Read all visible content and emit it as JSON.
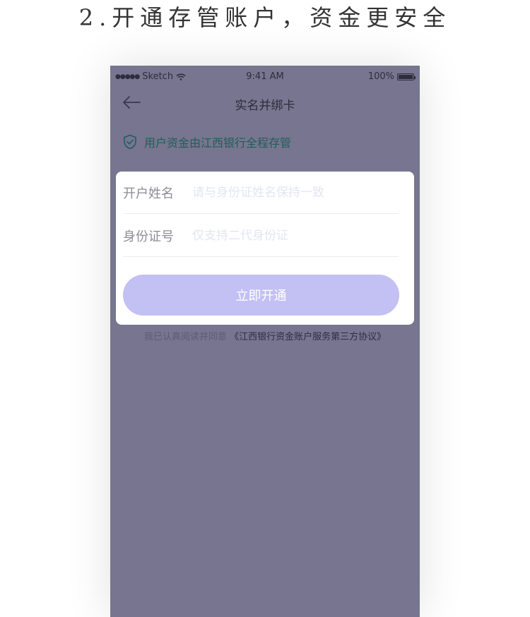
{
  "headline": "2.开通存管账户，资金更安全",
  "statusbar": {
    "carrier": "Sketch",
    "time": "9:41 AM",
    "battery": "100%"
  },
  "nav": {
    "title": "实名并绑卡"
  },
  "notice": {
    "text": "用户资金由江西银行全程存管"
  },
  "form": {
    "name_label": "开户姓名",
    "name_placeholder": "请与身份证姓名保持一致",
    "id_label": "身份证号",
    "id_placeholder": "仅支持二代身份证",
    "submit_label": "立即开通"
  },
  "agreement": {
    "prefix": "我已认真阅读并同意",
    "link": "《江西银行资金账户服务第三方协议》"
  },
  "colors": {
    "overlay": "#77758f",
    "button": "#c3c0f4",
    "notice": "#1f5f58"
  }
}
